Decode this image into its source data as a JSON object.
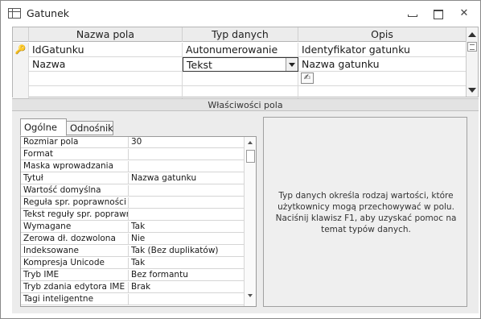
{
  "window": {
    "title": "Gatunek"
  },
  "grid": {
    "headers": {
      "name": "Nazwa pola",
      "type": "Typ danych",
      "desc": "Opis"
    },
    "rows": [
      {
        "key": "🔑",
        "name": "IdGatunku",
        "type": "Autonumerowanie",
        "desc": "Identyfikator gatunku"
      },
      {
        "key": "",
        "name": "Nazwa",
        "type": "Tekst",
        "desc": "Nazwa gatunku"
      },
      {
        "key": "",
        "name": "",
        "type": "",
        "desc": ""
      },
      {
        "key": "",
        "name": "",
        "type": "",
        "desc": ""
      }
    ]
  },
  "section_title": "Właściwości pola",
  "tabs": {
    "general": "Ogólne",
    "lookup": "Odnośnik"
  },
  "properties": [
    {
      "name": "Rozmiar pola",
      "value": "30"
    },
    {
      "name": "Format",
      "value": ""
    },
    {
      "name": "Maska wprowadzania",
      "value": ""
    },
    {
      "name": "Tytuł",
      "value": "Nazwa gatunku"
    },
    {
      "name": "Wartość domyślna",
      "value": ""
    },
    {
      "name": "Reguła spr. poprawności",
      "value": ""
    },
    {
      "name": "Tekst reguły spr. poprawności",
      "value": ""
    },
    {
      "name": "Wymagane",
      "value": "Tak"
    },
    {
      "name": "Zerowa dł. dozwolona",
      "value": "Nie"
    },
    {
      "name": "Indeksowane",
      "value": "Tak (Bez duplikatów)"
    },
    {
      "name": "Kompresja Unicode",
      "value": "Tak"
    },
    {
      "name": "Tryb IME",
      "value": "Bez formantu"
    },
    {
      "name": "Tryb zdania edytora IME",
      "value": "Brak"
    },
    {
      "name": "Tagi inteligentne",
      "value": ""
    }
  ],
  "help_text": "Typ danych określa rodzaj wartości, które użytkownicy mogą przechowywać w polu. Naciśnij klawisz F1, aby uzyskać pomoc na temat typów danych."
}
